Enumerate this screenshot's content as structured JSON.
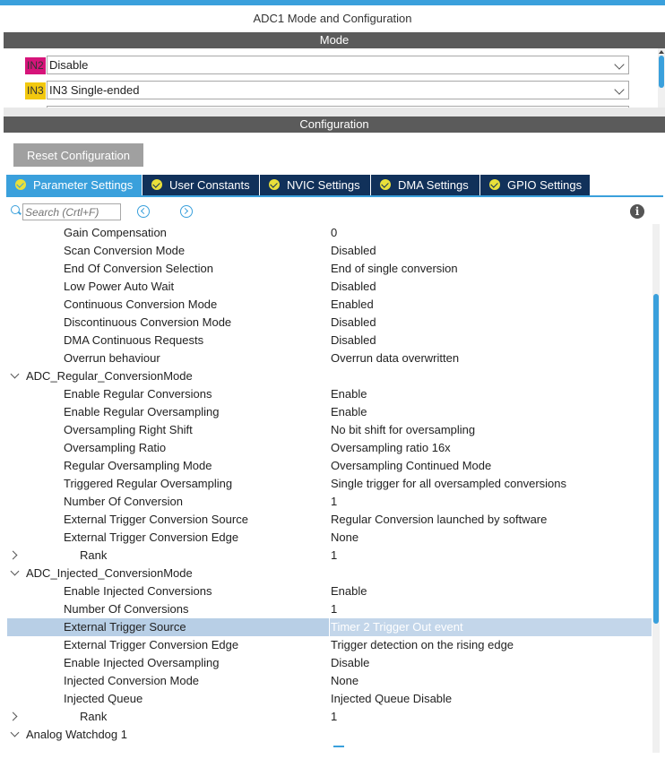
{
  "window_title": "ADC1 Mode and Configuration",
  "mode_section": {
    "label": "Mode",
    "rows": [
      {
        "pin": "IN2",
        "pin_color": "#d6147a",
        "value": "Disable"
      },
      {
        "pin": "IN3",
        "pin_color": "#f2c80f",
        "value": "IN3 Single-ended"
      },
      {
        "pin": "",
        "pin_color": "#d6147a",
        "value": ""
      }
    ]
  },
  "config_section": {
    "label": "Configuration",
    "reset_label": "Reset Configuration"
  },
  "tabs": [
    {
      "label": "Parameter Settings",
      "active": true
    },
    {
      "label": "User Constants",
      "active": false
    },
    {
      "label": "NVIC Settings",
      "active": false
    },
    {
      "label": "DMA Settings",
      "active": false
    },
    {
      "label": "GPIO Settings",
      "active": false
    }
  ],
  "search": {
    "placeholder": "Search (Crtl+F)"
  },
  "params": [
    {
      "name": "Gain Compensation",
      "value": "0"
    },
    {
      "name": "Scan Conversion Mode",
      "value": "Disabled"
    },
    {
      "name": "End Of Conversion Selection",
      "value": "End of single conversion"
    },
    {
      "name": "Low Power Auto Wait",
      "value": "Disabled"
    },
    {
      "name": "Continuous Conversion Mode",
      "value": "Enabled"
    },
    {
      "name": "Discontinuous Conversion Mode",
      "value": "Disabled"
    },
    {
      "name": "DMA Continuous Requests",
      "value": "Disabled"
    },
    {
      "name": "Overrun behaviour",
      "value": "Overrun data overwritten"
    },
    {
      "name": "ADC_Regular_ConversionMode",
      "value": "",
      "group": "open"
    },
    {
      "name": "Enable Regular Conversions",
      "value": "Enable"
    },
    {
      "name": "Enable Regular Oversampling",
      "value": "Enable"
    },
    {
      "name": "Oversampling Right Shift",
      "value": "No bit shift for oversampling"
    },
    {
      "name": "Oversampling Ratio",
      "value": "Oversampling ratio 16x"
    },
    {
      "name": "Regular Oversampling Mode",
      "value": "Oversampling Continued Mode"
    },
    {
      "name": "Triggered Regular Oversampling",
      "value": "Single trigger for all oversampled conversions"
    },
    {
      "name": "Number Of Conversion",
      "value": "1"
    },
    {
      "name": "External Trigger Conversion Source",
      "value": "Regular Conversion launched by software"
    },
    {
      "name": "External Trigger Conversion Edge",
      "value": "None"
    },
    {
      "name": "Rank",
      "value": "1",
      "group": "closed"
    },
    {
      "name": "ADC_Injected_ConversionMode",
      "value": "",
      "group": "open"
    },
    {
      "name": "Enable Injected Conversions",
      "value": "Enable"
    },
    {
      "name": "Number Of Conversions",
      "value": "1"
    },
    {
      "name": "External Trigger Source",
      "value": "Timer 2 Trigger Out event",
      "selected": true
    },
    {
      "name": "External Trigger Conversion Edge",
      "value": "Trigger detection on the rising edge"
    },
    {
      "name": "Enable Injected Oversampling",
      "value": "Disable"
    },
    {
      "name": "Injected Conversion Mode",
      "value": "None"
    },
    {
      "name": "Injected Queue",
      "value": "Injected Queue Disable"
    },
    {
      "name": "Rank",
      "value": "1",
      "group": "closed"
    },
    {
      "name": "Analog Watchdog 1",
      "value": "",
      "group": "open"
    }
  ]
}
